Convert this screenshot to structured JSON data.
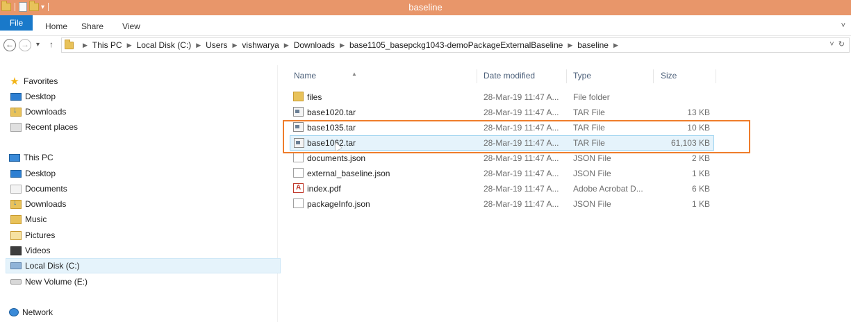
{
  "window": {
    "title": "baseline"
  },
  "ribbon": {
    "tabs": [
      "File",
      "Home",
      "Share",
      "View"
    ]
  },
  "address": {
    "path": [
      "This PC",
      "Local Disk (C:)",
      "Users",
      "vishwarya",
      "Downloads",
      "base1105_basepckg1043-demoPackageExternalBaseline",
      "baseline"
    ]
  },
  "sidebar": {
    "favorites_label": "Favorites",
    "favorites": [
      "Desktop",
      "Downloads",
      "Recent places"
    ],
    "thispc_label": "This PC",
    "thispc": [
      "Desktop",
      "Documents",
      "Downloads",
      "Music",
      "Pictures",
      "Videos",
      "Local Disk (C:)",
      "New Volume (E:)"
    ],
    "network_label": "Network",
    "selected": "Local Disk (C:)"
  },
  "columns": {
    "name": "Name",
    "date": "Date modified",
    "type": "Type",
    "size": "Size"
  },
  "files": [
    {
      "name": "files",
      "date": "28-Mar-19 11:47 A...",
      "type": "File folder",
      "size": "",
      "icon": "folder-icon"
    },
    {
      "name": "base1020.tar",
      "date": "28-Mar-19 11:47 A...",
      "type": "TAR File",
      "size": "13 KB",
      "icon": "tar-file-icon"
    },
    {
      "name": "base1035.tar",
      "date": "28-Mar-19 11:47 A...",
      "type": "TAR File",
      "size": "10 KB",
      "icon": "tar-file-icon"
    },
    {
      "name": "base1062.tar",
      "date": "28-Mar-19 11:47 A...",
      "type": "TAR File",
      "size": "61,103 KB",
      "icon": "tar-file-icon",
      "selected": true
    },
    {
      "name": "documents.json",
      "date": "28-Mar-19 11:47 A...",
      "type": "JSON File",
      "size": "2 KB",
      "icon": "json-file-icon"
    },
    {
      "name": "external_baseline.json",
      "date": "28-Mar-19 11:47 A...",
      "type": "JSON File",
      "size": "1 KB",
      "icon": "json-file-icon"
    },
    {
      "name": "index.pdf",
      "date": "28-Mar-19 11:47 A...",
      "type": "Adobe Acrobat D...",
      "size": "6 KB",
      "icon": "pdf-file-icon"
    },
    {
      "name": "packageInfo.json",
      "date": "28-Mar-19 11:47 A...",
      "type": "JSON File",
      "size": "1 KB",
      "icon": "json-file-icon"
    }
  ],
  "colors": {
    "titlebar": "#e8966a",
    "file_tab": "#1979ca",
    "highlight": "#ef7d2b",
    "selection": "#e5f3fb"
  }
}
